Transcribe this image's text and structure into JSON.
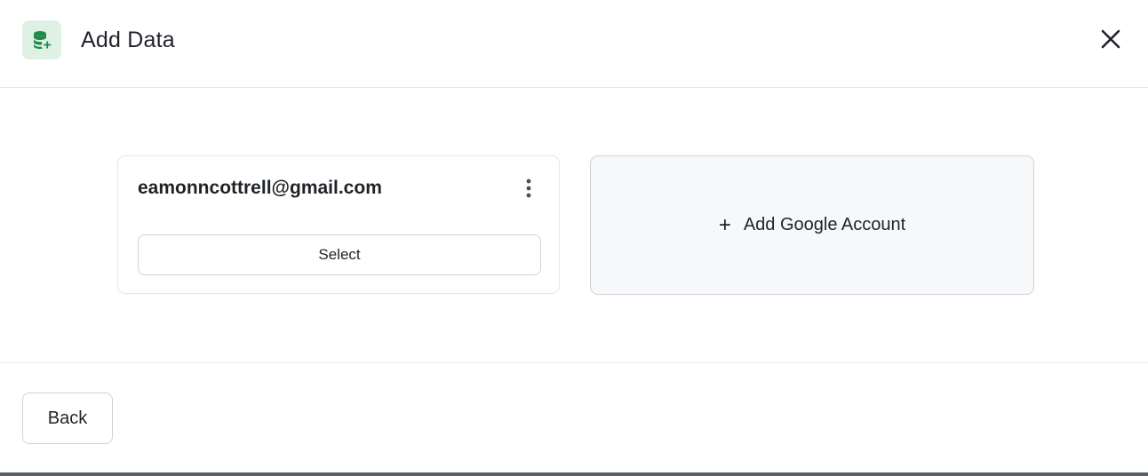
{
  "header": {
    "icon": "database-add-icon",
    "title": "Add Data",
    "close_icon": "close-icon"
  },
  "accounts": [
    {
      "email": "eamonncottrell@gmail.com",
      "menu_icon": "more-vertical-icon",
      "select_label": "Select"
    }
  ],
  "add_account": {
    "icon": "plus-icon",
    "label": "Add Google Account"
  },
  "footer": {
    "back_label": "Back"
  },
  "colors": {
    "accent_green": "#1f8a4c",
    "icon_bg": "#dff1e4",
    "add_card_bg": "#f7f8fa",
    "border": "#cfd3d9"
  }
}
